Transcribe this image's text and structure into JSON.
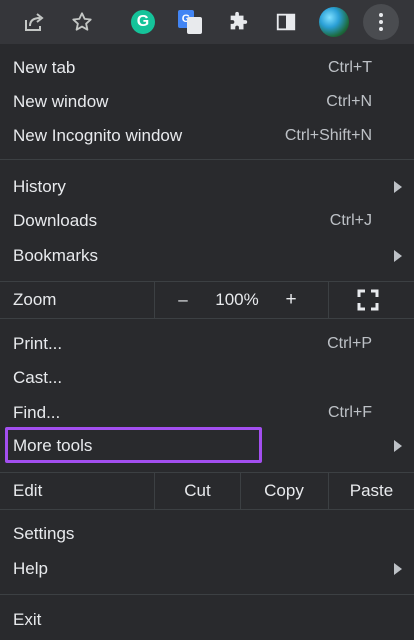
{
  "toolbar": {
    "icons": [
      "share-icon",
      "star-icon",
      "grammarly-icon",
      "google-translate-icon",
      "extensions-icon",
      "side-panel-icon",
      "profile-avatar",
      "more-menu-icon"
    ],
    "grammarly_letter": "G",
    "translate_letter": "G"
  },
  "menu": {
    "new_tab": {
      "label": "New tab",
      "shortcut": "Ctrl+T"
    },
    "new_window": {
      "label": "New window",
      "shortcut": "Ctrl+N"
    },
    "new_incognito": {
      "label": "New Incognito window",
      "shortcut": "Ctrl+Shift+N"
    },
    "history": {
      "label": "History"
    },
    "downloads": {
      "label": "Downloads",
      "shortcut": "Ctrl+J"
    },
    "bookmarks": {
      "label": "Bookmarks"
    },
    "zoom": {
      "label": "Zoom",
      "minus": "–",
      "value": "100%",
      "plus": "+"
    },
    "print": {
      "label": "Print...",
      "shortcut": "Ctrl+P"
    },
    "cast": {
      "label": "Cast..."
    },
    "find": {
      "label": "Find...",
      "shortcut": "Ctrl+F"
    },
    "more_tools": {
      "label": "More tools"
    },
    "edit": {
      "label": "Edit",
      "cut": "Cut",
      "copy": "Copy",
      "paste": "Paste"
    },
    "settings": {
      "label": "Settings"
    },
    "help": {
      "label": "Help"
    },
    "exit": {
      "label": "Exit"
    }
  },
  "colors": {
    "background": "#292a2d",
    "toolbar": "#35363a",
    "highlight": "#a34ff0",
    "grammarly": "#15c39a"
  }
}
